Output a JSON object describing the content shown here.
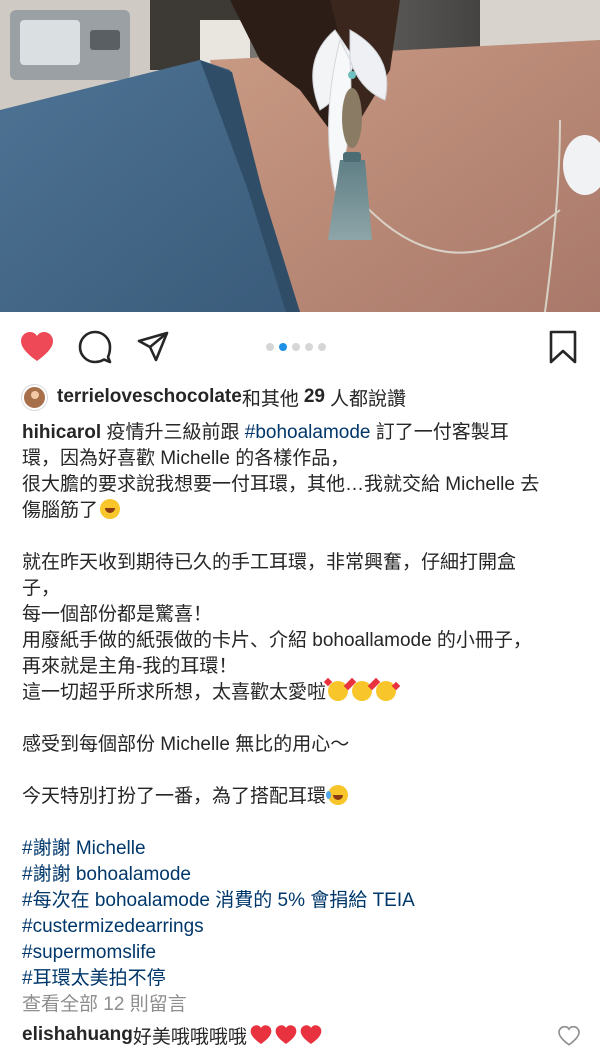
{
  "post": {
    "pager": {
      "total": 5,
      "active": 1
    },
    "likes": {
      "user": "terrieloveschocolate",
      "and_others": "和其他",
      "count": "29",
      "suffix": "人都說讚"
    },
    "caption": {
      "author": "hihicarol",
      "l1_a": " 疫情升三級前跟 ",
      "l1_tag": "#bohoalamode",
      "l1_b": " 訂了一付客製耳",
      "l2": "環，因為好喜歡 Michelle 的各樣作品，",
      "l3": "很大膽的要求說我想要一付耳環，其他…我就交給 Michelle 去",
      "l4": "傷腦筋了",
      "l6": "就在昨天收到期待已久的手工耳環，非常興奮，仔細打開盒",
      "l7": "子，",
      "l8": "每一個部份都是驚喜！",
      "l9": "用廢紙手做的紙張做的卡片、介紹 bohoallamode 的小冊子，",
      "l10": "再來就是主角-我的耳環！",
      "l11": "這一切超乎所求所想，太喜歡太愛啦",
      "l13": "感受到每個部份 Michelle 無比的用心～",
      "l15": "今天特別打扮了一番，為了搭配耳環",
      "tags": [
        "#謝謝 Michelle",
        "#謝謝 bohoalamode",
        "#每次在 bohoalamode 消費的 5% 會捐給 TEIA",
        "#custermizedearrings",
        "#supermomslife",
        "#耳環太美拍不停"
      ]
    },
    "view_comments": "查看全部 12 則留言",
    "comment": {
      "user": "elishahuang",
      "text": " 好美哦哦哦哦"
    }
  },
  "colors": {
    "like_red": "#ed4956",
    "hashtag_blue": "#00376b",
    "active_dot": "#1e90e8",
    "muted_gray": "#8e8e8e"
  },
  "icons": [
    "heart-filled-icon",
    "comment-icon",
    "share-icon",
    "bookmark-icon",
    "heart-outline-icon"
  ]
}
